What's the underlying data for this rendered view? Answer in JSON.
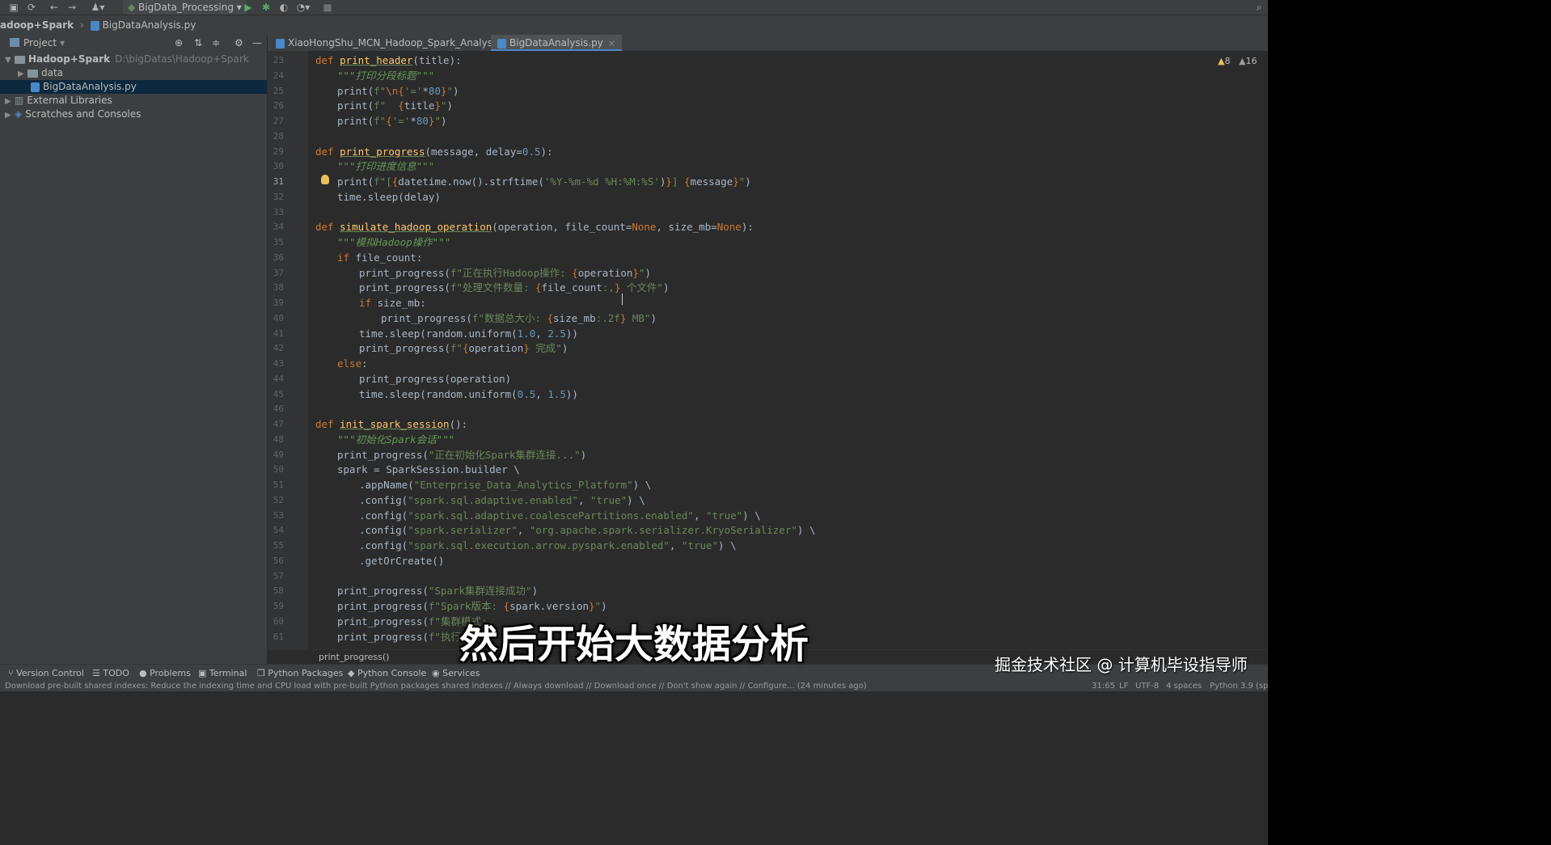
{
  "toolbar": {
    "run_config": "BigData_Processing"
  },
  "breadcrumb": {
    "project": "adoop+Spark",
    "file": "BigDataAnalysis.py"
  },
  "project_panel": {
    "title": "Project",
    "items": [
      {
        "label": "Hadoop+Spark",
        "path": "D:\\bigDatas\\Hadoop+Spark"
      },
      {
        "label": "data"
      },
      {
        "label": "BigDataAnalysis.py"
      },
      {
        "label": "External Libraries"
      },
      {
        "label": "Scratches and Consoles"
      }
    ]
  },
  "tabs": [
    {
      "label": "XiaoHongShu_MCN_Hadoop_Spark_Analysis.py"
    },
    {
      "label": "BigDataAnalysis.py"
    }
  ],
  "inspections": {
    "warnings": "8",
    "weak_warnings": "16"
  },
  "editor": {
    "current_line": "31",
    "lines": [
      {
        "n": "23",
        "indent": 0,
        "code": [
          [
            "kw",
            "def "
          ],
          [
            "fn",
            "print_header"
          ],
          [
            "plain",
            "(title):"
          ]
        ]
      },
      {
        "n": "24",
        "indent": 1,
        "code": [
          [
            "doc",
            "\"\"\"打印分段标题\"\"\""
          ]
        ]
      },
      {
        "n": "25",
        "indent": 1,
        "code": [
          [
            "plain",
            "print("
          ],
          [
            "str",
            "f\""
          ],
          [
            "kw",
            "\\n"
          ],
          [
            "brace",
            "{"
          ],
          [
            "str",
            "'='"
          ],
          [
            "plain",
            "*"
          ],
          [
            "num",
            "80"
          ],
          [
            "brace",
            "}"
          ],
          [
            "str",
            "\""
          ],
          [
            "plain",
            ")"
          ]
        ]
      },
      {
        "n": "26",
        "indent": 1,
        "code": [
          [
            "plain",
            "print("
          ],
          [
            "str",
            "f\"  "
          ],
          [
            "brace",
            "{"
          ],
          [
            "plain",
            "title"
          ],
          [
            "brace",
            "}"
          ],
          [
            "str",
            "\""
          ],
          [
            "plain",
            ")"
          ]
        ]
      },
      {
        "n": "27",
        "indent": 1,
        "code": [
          [
            "plain",
            "print("
          ],
          [
            "str",
            "f\""
          ],
          [
            "brace",
            "{"
          ],
          [
            "str",
            "'='"
          ],
          [
            "plain",
            "*"
          ],
          [
            "num",
            "80"
          ],
          [
            "brace",
            "}"
          ],
          [
            "str",
            "\""
          ],
          [
            "plain",
            ")"
          ]
        ]
      },
      {
        "n": "28",
        "indent": 0,
        "code": []
      },
      {
        "n": "29",
        "indent": 0,
        "code": [
          [
            "kw",
            "def "
          ],
          [
            "fn",
            "print_progress"
          ],
          [
            "plain",
            "(message, delay="
          ],
          [
            "num",
            "0.5"
          ],
          [
            "plain",
            "):"
          ]
        ]
      },
      {
        "n": "30",
        "indent": 1,
        "code": [
          [
            "doc",
            "\"\"\"打印进度信息\"\"\""
          ]
        ]
      },
      {
        "n": "31",
        "indent": 1,
        "code": [
          [
            "plain",
            "print("
          ],
          [
            "str",
            "f\"["
          ],
          [
            "brace",
            "{"
          ],
          [
            "plain",
            "datetime.now().strftime("
          ],
          [
            "str",
            "'%Y-%m-%d %H:%M:%S'"
          ],
          [
            "plain",
            ")"
          ],
          [
            "brace",
            "}"
          ],
          [
            "str",
            "] "
          ],
          [
            "brace",
            "{"
          ],
          [
            "plain",
            "message"
          ],
          [
            "brace",
            "}"
          ],
          [
            "str",
            "\""
          ],
          [
            "plain",
            ")"
          ]
        ]
      },
      {
        "n": "32",
        "indent": 1,
        "code": [
          [
            "plain",
            "time.sleep(delay)"
          ]
        ]
      },
      {
        "n": "33",
        "indent": 0,
        "code": []
      },
      {
        "n": "34",
        "indent": 0,
        "code": [
          [
            "kw",
            "def "
          ],
          [
            "fn",
            "simulate_hadoop_operation"
          ],
          [
            "plain",
            "(operation, file_count="
          ],
          [
            "kw",
            "None"
          ],
          [
            "plain",
            ", size_mb="
          ],
          [
            "kw",
            "None"
          ],
          [
            "plain",
            "):"
          ]
        ]
      },
      {
        "n": "35",
        "indent": 1,
        "code": [
          [
            "doc",
            "\"\"\"模拟Hadoop操作\"\"\""
          ]
        ]
      },
      {
        "n": "36",
        "indent": 1,
        "code": [
          [
            "kw",
            "if "
          ],
          [
            "plain",
            "file_count:"
          ]
        ]
      },
      {
        "n": "37",
        "indent": 2,
        "code": [
          [
            "plain",
            "print_progress("
          ],
          [
            "str",
            "f\"正在执行Hadoop操作: "
          ],
          [
            "brace",
            "{"
          ],
          [
            "plain",
            "operation"
          ],
          [
            "brace",
            "}"
          ],
          [
            "str",
            "\""
          ],
          [
            "plain",
            ")"
          ]
        ]
      },
      {
        "n": "38",
        "indent": 2,
        "code": [
          [
            "plain",
            "print_progress("
          ],
          [
            "str",
            "f\"处理文件数量: "
          ],
          [
            "brace",
            "{"
          ],
          [
            "plain",
            "file_count"
          ],
          [
            "str",
            ":,"
          ],
          [
            "brace",
            "}"
          ],
          [
            "str",
            " 个文件\""
          ],
          [
            "plain",
            ")"
          ]
        ]
      },
      {
        "n": "39",
        "indent": 2,
        "code": [
          [
            "kw",
            "if "
          ],
          [
            "plain",
            "size_mb:"
          ]
        ]
      },
      {
        "n": "40",
        "indent": 3,
        "code": [
          [
            "plain",
            "print_progress("
          ],
          [
            "str",
            "f\"数据总大小: "
          ],
          [
            "brace",
            "{"
          ],
          [
            "plain",
            "size_mb"
          ],
          [
            "str",
            ":.2f"
          ],
          [
            "brace",
            "}"
          ],
          [
            "str",
            " MB\""
          ],
          [
            "plain",
            ")"
          ]
        ]
      },
      {
        "n": "41",
        "indent": 2,
        "code": [
          [
            "plain",
            "time.sleep(random.uniform("
          ],
          [
            "num",
            "1.0"
          ],
          [
            "plain",
            ", "
          ],
          [
            "num",
            "2.5"
          ],
          [
            "plain",
            "))"
          ]
        ]
      },
      {
        "n": "42",
        "indent": 2,
        "code": [
          [
            "plain",
            "print_progress("
          ],
          [
            "str",
            "f\""
          ],
          [
            "brace",
            "{"
          ],
          [
            "plain",
            "operation"
          ],
          [
            "brace",
            "}"
          ],
          [
            "str",
            " 完成\""
          ],
          [
            "plain",
            ")"
          ]
        ]
      },
      {
        "n": "43",
        "indent": 1,
        "code": [
          [
            "kw",
            "else"
          ],
          [
            "plain",
            ":"
          ]
        ]
      },
      {
        "n": "44",
        "indent": 2,
        "code": [
          [
            "plain",
            "print_progress(operation)"
          ]
        ]
      },
      {
        "n": "45",
        "indent": 2,
        "code": [
          [
            "plain",
            "time.sleep(random.uniform("
          ],
          [
            "num",
            "0.5"
          ],
          [
            "plain",
            ", "
          ],
          [
            "num",
            "1.5"
          ],
          [
            "plain",
            "))"
          ]
        ]
      },
      {
        "n": "46",
        "indent": 0,
        "code": []
      },
      {
        "n": "47",
        "indent": 0,
        "code": [
          [
            "kw",
            "def "
          ],
          [
            "fn",
            "init_spark_session"
          ],
          [
            "plain",
            "():"
          ]
        ]
      },
      {
        "n": "48",
        "indent": 1,
        "code": [
          [
            "doc",
            "\"\"\"初始化Spark会话\"\"\""
          ]
        ]
      },
      {
        "n": "49",
        "indent": 1,
        "code": [
          [
            "plain",
            "print_progress("
          ],
          [
            "str",
            "\"正在初始化Spark集群连接...\""
          ],
          [
            "plain",
            ")"
          ]
        ]
      },
      {
        "n": "50",
        "indent": 1,
        "code": [
          [
            "plain",
            "spark = SparkSession.builder \\"
          ]
        ]
      },
      {
        "n": "51",
        "indent": 2,
        "code": [
          [
            "plain",
            ".appName("
          ],
          [
            "str",
            "\"Enterprise_Data_Analytics_Platform\""
          ],
          [
            "plain",
            ") \\"
          ]
        ]
      },
      {
        "n": "52",
        "indent": 2,
        "code": [
          [
            "plain",
            ".config("
          ],
          [
            "str",
            "\"spark.sql.adaptive.enabled\""
          ],
          [
            "plain",
            ", "
          ],
          [
            "str",
            "\"true\""
          ],
          [
            "plain",
            ") \\"
          ]
        ]
      },
      {
        "n": "53",
        "indent": 2,
        "code": [
          [
            "plain",
            ".config("
          ],
          [
            "str",
            "\"spark.sql.adaptive.coalescePartitions.enabled\""
          ],
          [
            "plain",
            ", "
          ],
          [
            "str",
            "\"true\""
          ],
          [
            "plain",
            ") \\"
          ]
        ]
      },
      {
        "n": "54",
        "indent": 2,
        "code": [
          [
            "plain",
            ".config("
          ],
          [
            "str",
            "\"spark.serializer\""
          ],
          [
            "plain",
            ", "
          ],
          [
            "str",
            "\"org.apache.spark.serializer.KryoSerializer\""
          ],
          [
            "plain",
            ") \\"
          ]
        ]
      },
      {
        "n": "55",
        "indent": 2,
        "code": [
          [
            "plain",
            ".config("
          ],
          [
            "str",
            "\"spark.sql.execution.arrow.pyspark.enabled\""
          ],
          [
            "plain",
            ", "
          ],
          [
            "str",
            "\"true\""
          ],
          [
            "plain",
            ") \\"
          ]
        ]
      },
      {
        "n": "56",
        "indent": 2,
        "code": [
          [
            "plain",
            ".getOrCreate()"
          ]
        ]
      },
      {
        "n": "57",
        "indent": 0,
        "code": []
      },
      {
        "n": "58",
        "indent": 1,
        "code": [
          [
            "plain",
            "print_progress("
          ],
          [
            "str",
            "\"Spark集群连接成功\""
          ],
          [
            "plain",
            ")"
          ]
        ]
      },
      {
        "n": "59",
        "indent": 1,
        "code": [
          [
            "plain",
            "print_progress("
          ],
          [
            "str",
            "f\"Spark版本: "
          ],
          [
            "brace",
            "{"
          ],
          [
            "plain",
            "spark.version"
          ],
          [
            "brace",
            "}"
          ],
          [
            "str",
            "\""
          ],
          [
            "plain",
            ")"
          ]
        ]
      },
      {
        "n": "60",
        "indent": 1,
        "code": [
          [
            "plain",
            "print_progress("
          ],
          [
            "str",
            "f\"集群模式: "
          ]
        ]
      },
      {
        "n": "61",
        "indent": 1,
        "code": [
          [
            "plain",
            "print_progress("
          ],
          [
            "str",
            "f\"执行器数"
          ]
        ]
      }
    ]
  },
  "scope_breadcrumb": "print_progress()",
  "bottom_tools": [
    {
      "label": "Version Control",
      "icon": "branch-icon"
    },
    {
      "label": "TODO",
      "icon": "list-icon"
    },
    {
      "label": "Problems",
      "icon": "info-icon"
    },
    {
      "label": "Terminal",
      "icon": "terminal-icon"
    },
    {
      "label": "Python Packages",
      "icon": "packages-icon"
    },
    {
      "label": "Python Console",
      "icon": "console-icon"
    },
    {
      "label": "Services",
      "icon": "services-icon"
    }
  ],
  "status": {
    "message": "Download pre-built shared indexes: Reduce the indexing time and CPU load with pre-built Python packages shared indexes // Always download // Download once // Don't show again // Configure... (24 minutes ago)",
    "position": "31:65",
    "line_sep": "LF",
    "encoding": "UTF-8",
    "indent": "4 spaces",
    "interpreter": "Python 3.9 (sp"
  },
  "overlay": {
    "subtitle": "然后开始大数据分析",
    "watermark": "掘金技术社区 @ 计算机毕设指导师"
  }
}
